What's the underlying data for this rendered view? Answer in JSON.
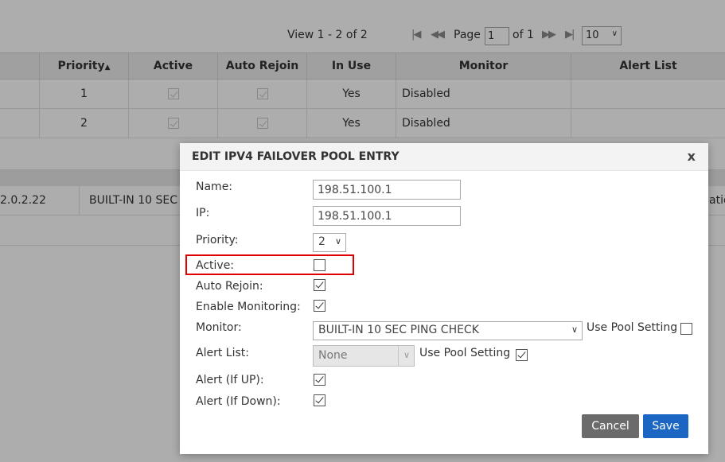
{
  "pager": {
    "view_text": "View 1 - 2 of 2",
    "page_label": "Page",
    "page_value": "1",
    "of_label": "of 1",
    "rows_per_page": "10"
  },
  "grid": {
    "columns": [
      "Priority",
      "Active",
      "Auto Rejoin",
      "In Use",
      "Monitor",
      "Alert List"
    ],
    "rows": [
      {
        "priority": "1",
        "in_use": "Yes",
        "monitor": "Disabled"
      },
      {
        "priority": "2",
        "in_use": "Yes",
        "monitor": "Disabled"
      }
    ],
    "lower_row": {
      "ip_fragment": "2.0.2.22",
      "monitor_fragment": "BUILT-IN 10 SEC P",
      "alert_fragment": "atio"
    }
  },
  "dialog": {
    "title": "EDIT IPV4 FAILOVER POOL ENTRY",
    "close_label": "x",
    "labels": {
      "name": "Name:",
      "ip": "IP:",
      "priority": "Priority:",
      "active": "Active:",
      "auto_rejoin": "Auto Rejoin:",
      "enable_monitoring": "Enable Monitoring:",
      "monitor": "Monitor:",
      "alert_list": "Alert List:",
      "alert_up": "Alert (If UP):",
      "alert_down": "Alert (If Down):"
    },
    "values": {
      "name": "198.51.100.1",
      "ip": "198.51.100.1",
      "priority": "2",
      "monitor": "BUILT-IN 10 SEC PING CHECK",
      "alert_list": "None"
    },
    "use_pool_setting_label": "Use Pool Setting",
    "checkboxes": {
      "active": false,
      "auto_rejoin": true,
      "enable_monitoring": true,
      "monitor_use_pool": false,
      "alert_list_use_pool": true,
      "alert_up": true,
      "alert_down": true
    },
    "buttons": {
      "cancel": "Cancel",
      "save": "Save"
    },
    "colors": {
      "save": "#1a66c2",
      "cancel": "#6b6b6b",
      "highlight": "#e00000"
    }
  }
}
